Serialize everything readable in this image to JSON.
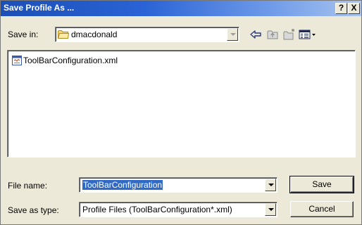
{
  "window": {
    "title": "Save Profile As ...",
    "help_label": "?",
    "close_label": "X"
  },
  "save_in": {
    "label": "Save in:",
    "folder": "dmacdonald"
  },
  "toolbar": {
    "icons": [
      "back-arrow-icon",
      "up-folder-icon",
      "new-folder-icon",
      "view-menu-icon"
    ]
  },
  "files": [
    {
      "name": "ToolBarConfiguration.xml",
      "icon": "xml-file-icon"
    }
  ],
  "file_name": {
    "label": "File name:",
    "value": "ToolBarConfiguration"
  },
  "save_as_type": {
    "label": "Save as type:",
    "value": "Profile Files  (ToolBarConfiguration*.xml)"
  },
  "buttons": {
    "save": "Save",
    "cancel": "Cancel"
  },
  "colors": {
    "title_bar": "#2a63d6",
    "dialog_bg": "#ece9d8",
    "selection": "#316ac5"
  }
}
